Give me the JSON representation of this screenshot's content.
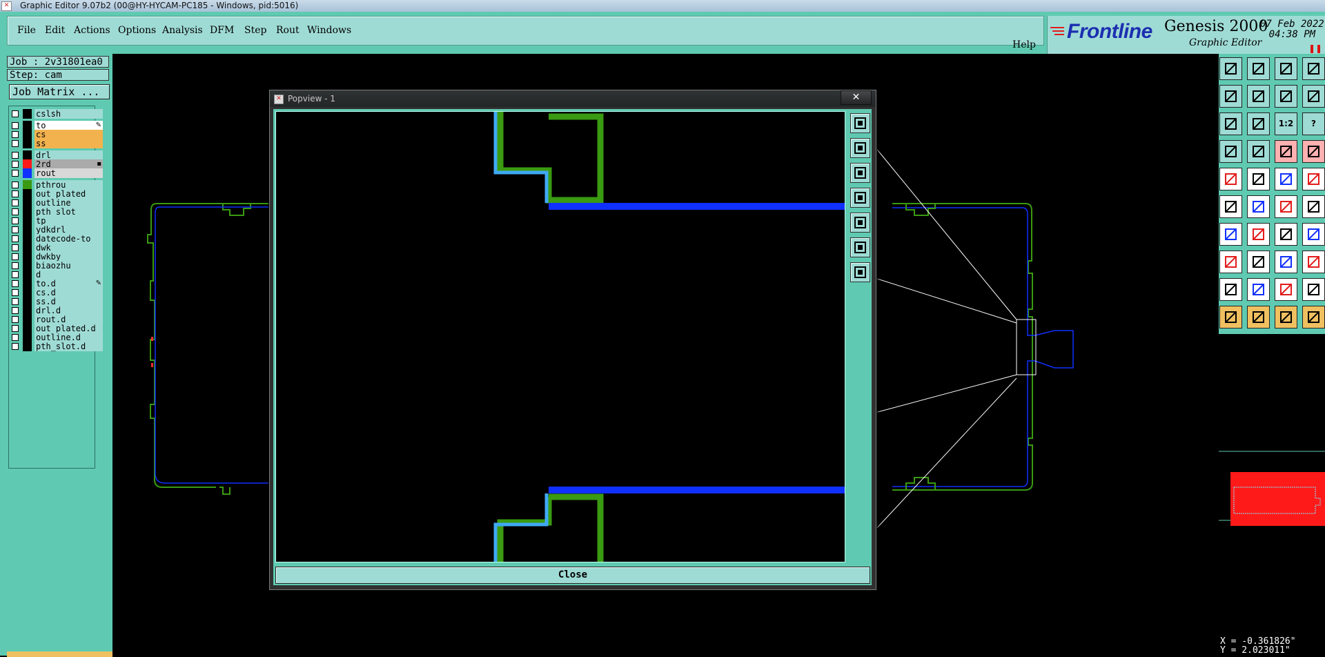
{
  "window": {
    "title": "Graphic Editor 9.07b2 (00@HY-HYCAM-PC185 - Windows, pid:5016)"
  },
  "menu": {
    "items": [
      "File",
      "Edit",
      "Actions",
      "Options",
      "Analysis",
      "DFM",
      "Step",
      "Rout",
      "Windows"
    ],
    "help": "Help"
  },
  "branding": {
    "logo": "Frontline",
    "product": "Genesis 2000",
    "subtitle": "Graphic Editor",
    "date": "07 Feb 2022",
    "time": "04:38 PM",
    "pause_glyph": "❚❚"
  },
  "job": {
    "job_label": "Job : 2v31801ea0",
    "step_label": "Step: cam",
    "matrix_button": "Job Matrix ..."
  },
  "layers": [
    {
      "name": "cslsh",
      "swatch": "#000000",
      "bg": "#9fdbd5",
      "group": 0
    },
    {
      "name": "to",
      "swatch": "#000000",
      "bg": "#ffffff",
      "group": 1,
      "marker": "✎"
    },
    {
      "name": "cs",
      "swatch": "#000000",
      "bg": "#f2b24e",
      "group": 1
    },
    {
      "name": "ss",
      "swatch": "#000000",
      "bg": "#f2b24e",
      "group": 1
    },
    {
      "name": "drl",
      "swatch": "#000000",
      "bg": "#9fdbd5",
      "group": 2
    },
    {
      "name": "2rd",
      "swatch": "#ff1a1a",
      "bg": "#aaaaaa",
      "group": 2,
      "marker": "▪"
    },
    {
      "name": "rout",
      "swatch": "#1030ff",
      "bg": "#d8d8d8",
      "group": 2
    },
    {
      "name": "pthrou",
      "swatch": "#3a9a12",
      "bg": "#9fdbd5",
      "group": 3
    },
    {
      "name": "out_plated",
      "swatch": "#000000",
      "bg": "#9fdbd5",
      "group": 3
    },
    {
      "name": "outline",
      "swatch": "#000000",
      "bg": "#9fdbd5",
      "group": 3
    },
    {
      "name": "pth_slot",
      "swatch": "#000000",
      "bg": "#9fdbd5",
      "group": 3
    },
    {
      "name": "tp",
      "swatch": "#000000",
      "bg": "#9fdbd5",
      "group": 3
    },
    {
      "name": "ydkdrl",
      "swatch": "#000000",
      "bg": "#9fdbd5",
      "group": 3
    },
    {
      "name": "datecode-to",
      "swatch": "#000000",
      "bg": "#9fdbd5",
      "group": 3
    },
    {
      "name": "dwk",
      "swatch": "#000000",
      "bg": "#9fdbd5",
      "group": 3
    },
    {
      "name": "dwkby",
      "swatch": "#000000",
      "bg": "#9fdbd5",
      "group": 3
    },
    {
      "name": "biaozhu",
      "swatch": "#000000",
      "bg": "#9fdbd5",
      "group": 3
    },
    {
      "name": "d",
      "swatch": "#000000",
      "bg": "#9fdbd5",
      "group": 3
    },
    {
      "name": "to.d",
      "swatch": "#000000",
      "bg": "#9fdbd5",
      "group": 3,
      "marker": "✎"
    },
    {
      "name": "cs.d",
      "swatch": "#000000",
      "bg": "#9fdbd5",
      "group": 3
    },
    {
      "name": "ss.d",
      "swatch": "#000000",
      "bg": "#9fdbd5",
      "group": 3
    },
    {
      "name": "drl.d",
      "swatch": "#000000",
      "bg": "#9fdbd5",
      "group": 3
    },
    {
      "name": "rout.d",
      "swatch": "#000000",
      "bg": "#9fdbd5",
      "group": 3
    },
    {
      "name": "out_plated.d",
      "swatch": "#000000",
      "bg": "#9fdbd5",
      "group": 3
    },
    {
      "name": "outline.d",
      "swatch": "#000000",
      "bg": "#9fdbd5",
      "group": 3
    },
    {
      "name": "pth_slot.d",
      "swatch": "#000000",
      "bg": "#9fdbd5",
      "group": 3
    }
  ],
  "popview": {
    "title": "Popview - 1",
    "close_x": "✕",
    "close_button": "Close",
    "side_buttons": [
      "zoom-window-icon",
      "pan-up-icon",
      "pan-down-icon",
      "pan-left-icon",
      "pan-right-icon",
      "fit-home-icon",
      "zoom-reset-icon"
    ]
  },
  "toolbox": {
    "rows": [
      {
        "bg": "#9fdbd5",
        "icons": [
          "import-icon",
          "export-icon",
          "home-icon",
          "split-icon"
        ]
      },
      {
        "bg": "#9fdbd5",
        "icons": [
          "move-left-icon",
          "move-right-icon",
          "rotate-icon",
          "mirror-icon"
        ]
      },
      {
        "bg": "#9fdbd5",
        "icons": [
          "fit-icon",
          "center-icon",
          "scale-icon",
          "query-icon"
        ]
      },
      {
        "bg": "#9fdbd5",
        "icons": [
          "snap-icon",
          "measure-icon",
          "red-node-icon",
          "layer-icon"
        ]
      },
      {
        "bg": "#ffffff",
        "icons": [
          "select-feature-icon",
          "zoom-area-icon",
          "ruler-icon",
          "pad-icon"
        ]
      },
      {
        "bg": "#ffffff",
        "icons": [
          "connect-icon",
          "delete-node-icon",
          "add-node-icon",
          "add-line-icon"
        ]
      },
      {
        "bg": "#ffffff",
        "icons": [
          "angle-icon",
          "line-icon",
          "arc-icon",
          "text-icon"
        ]
      },
      {
        "bg": "#ffffff",
        "icons": [
          "route-icon",
          "dash-icon",
          "dimension-icon",
          "shape-icon"
        ]
      },
      {
        "bg": "#ffffff",
        "icons": [
          "triangle-icon",
          "arrow-up-icon",
          "peak-icon",
          "slope-icon"
        ]
      },
      {
        "bg": "#f0c060",
        "icons": [
          "pointer-icon",
          "pointer-select-icon",
          "pointer-box-icon",
          "pointer-multi-icon"
        ]
      }
    ],
    "labels": {
      "scale": "1:2",
      "help": "?"
    }
  },
  "status": {
    "x": "X = -0.361826\"",
    "y": "Y =  2.023011\""
  },
  "colors": {
    "teal": "#5fcab1",
    "light_teal": "#9fdbd5",
    "rout_blue": "#1030ff",
    "pth_green": "#3a9a12",
    "light_blue": "#3fa9f5"
  }
}
